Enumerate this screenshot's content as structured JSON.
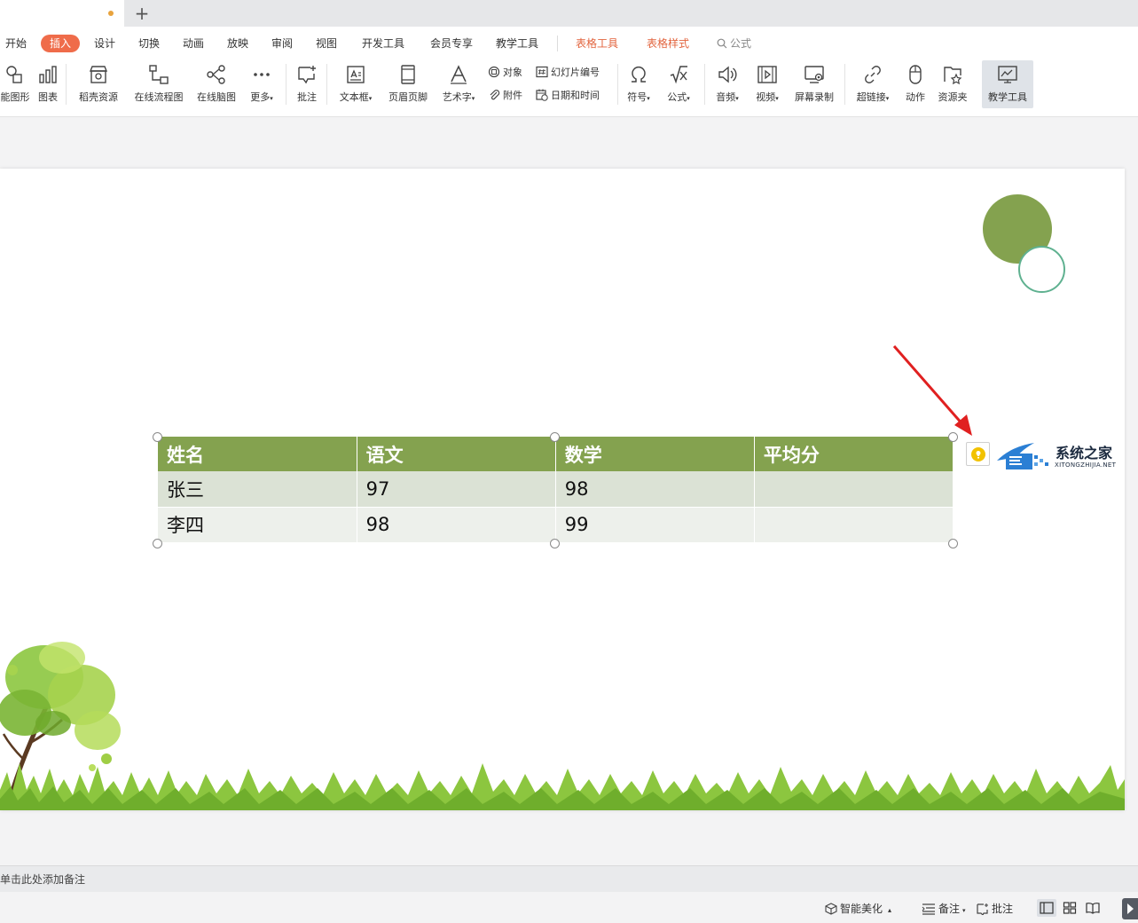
{
  "tabbar": {
    "new_tab_label": "+"
  },
  "menu": {
    "tabs": [
      {
        "label": "开始",
        "name": "tab-home"
      },
      {
        "label": "插入",
        "name": "tab-insert",
        "active": true
      },
      {
        "label": "设计",
        "name": "tab-design"
      },
      {
        "label": "切换",
        "name": "tab-transition"
      },
      {
        "label": "动画",
        "name": "tab-animation"
      },
      {
        "label": "放映",
        "name": "tab-slideshow"
      },
      {
        "label": "审阅",
        "name": "tab-review"
      },
      {
        "label": "视图",
        "name": "tab-view"
      },
      {
        "label": "开发工具",
        "name": "tab-developer"
      },
      {
        "label": "会员专享",
        "name": "tab-member"
      },
      {
        "label": "教学工具",
        "name": "tab-teaching"
      },
      {
        "label": "表格工具",
        "name": "tab-table-tools",
        "context": true
      },
      {
        "label": "表格样式",
        "name": "tab-table-style",
        "context": true
      }
    ],
    "search_text": "公式"
  },
  "ribbon": {
    "smart_shape": "能图形",
    "chart": "图表",
    "docer_resources": "稻壳资源",
    "online_flowchart": "在线流程图",
    "online_mindmap": "在线脑图",
    "more": "更多",
    "comment": "批注",
    "textbox": "文本框",
    "header_footer": "页眉页脚",
    "wordart": "艺术字",
    "object": "对象",
    "attachment": "附件",
    "slide_number": "幻灯片编号",
    "date_time": "日期和时间",
    "symbol": "符号",
    "formula": "公式",
    "audio": "音频",
    "video": "视频",
    "screen_record": "屏幕录制",
    "hyperlink": "超链接",
    "action": "动作",
    "resource_folder": "资源夹",
    "teaching_tools": "教学工具"
  },
  "table": {
    "headers": [
      "姓名",
      "语文",
      "数学",
      "平均分"
    ],
    "rows": [
      [
        "张三",
        "97",
        "98",
        ""
      ],
      [
        "李四",
        "98",
        "99",
        ""
      ]
    ]
  },
  "watermark": {
    "title": "系统之家",
    "subtitle": "XITONGZHIJIA.NET"
  },
  "notes_placeholder": "单击此处添加备注",
  "status": {
    "smart_beautify": "智能美化",
    "notes": "备注",
    "comment": "批注"
  },
  "colors": {
    "accent": "#ef6c4a",
    "table_header": "#84a24f",
    "table_row1": "#dbe2d5",
    "table_row2": "#edf0eb",
    "deco_filled": "#84a24f",
    "deco_outline": "#5fb190",
    "arrow": "#e02020"
  }
}
